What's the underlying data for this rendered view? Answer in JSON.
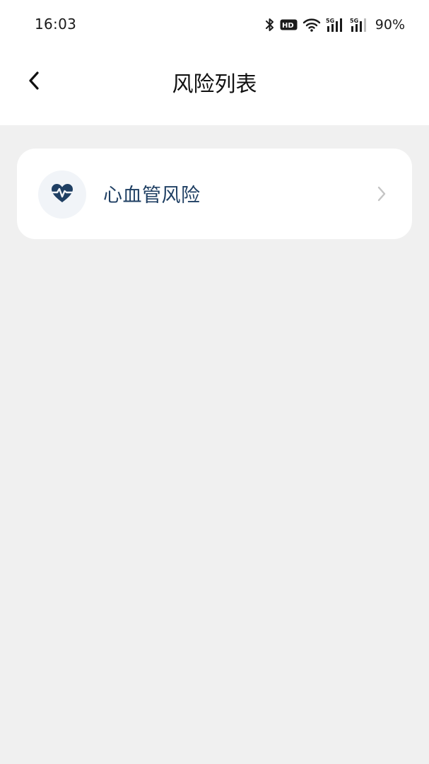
{
  "status_bar": {
    "time": "16:03",
    "battery": "90%",
    "icons": [
      "bluetooth-icon",
      "hd-voice-icon",
      "wifi-icon",
      "signal-5g-icon",
      "signal-5g-icon"
    ]
  },
  "header": {
    "title": "风险列表",
    "back_icon": "chevron-left-icon"
  },
  "risk_list": [
    {
      "label": "心血管风险",
      "icon": "heart-pulse-icon",
      "chevron": "chevron-right-icon"
    }
  ],
  "colors": {
    "page_background": "#f0f0f0",
    "card_background": "#ffffff",
    "accent": "#1f3f63",
    "icon_circle": "#f1f4f8",
    "chevron": "#c4c4c4"
  }
}
